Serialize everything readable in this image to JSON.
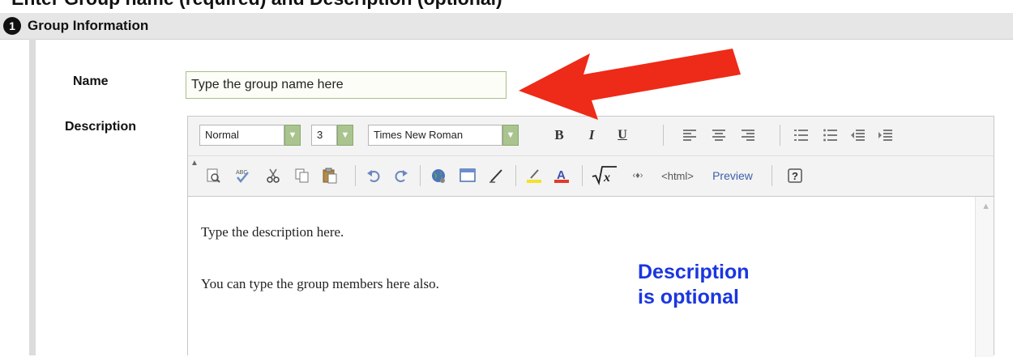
{
  "page": {
    "heading": "Enter Group name (required) and Description (optional)"
  },
  "section": {
    "number": "1",
    "title": "Group Information"
  },
  "name_field": {
    "label": "Name",
    "value": "Type the group name here"
  },
  "description_field": {
    "label": "Description"
  },
  "editor": {
    "format_select": "Normal",
    "size_select": "3",
    "font_select": "Times New Roman",
    "format_buttons": [
      {
        "name": "bold-button",
        "text": "B"
      },
      {
        "name": "italic-button",
        "text": "I"
      },
      {
        "name": "underline-button",
        "text": "U"
      }
    ],
    "html_button": "<html>",
    "preview_button": "Preview",
    "content": [
      "Type the description here.",
      "You can type the group members here also."
    ]
  },
  "annotations": {
    "callout_line1": "Description",
    "callout_line2": "is optional",
    "arrow_color": "#ee2a18",
    "callout_color": "#1a36e0"
  }
}
